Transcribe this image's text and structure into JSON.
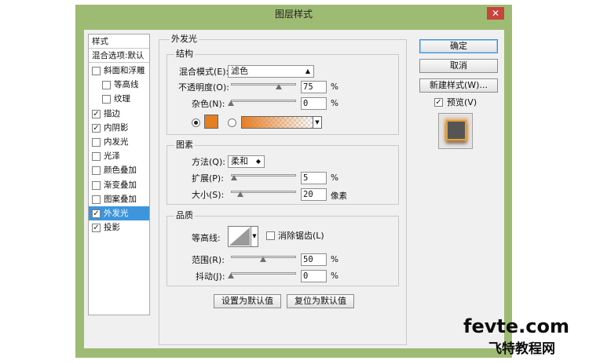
{
  "window": {
    "title": "图层样式",
    "close_glyph": "✕"
  },
  "style_list": {
    "header": "样式",
    "blend_options": "混合选项:默认",
    "items": [
      {
        "label": "斜面和浮雕",
        "checked": false
      },
      {
        "label": "等高线",
        "checked": false
      },
      {
        "label": "纹理",
        "checked": false
      },
      {
        "label": "描边",
        "checked": true
      },
      {
        "label": "内阴影",
        "checked": true
      },
      {
        "label": "内发光",
        "checked": false
      },
      {
        "label": "光泽",
        "checked": false
      },
      {
        "label": "颜色叠加",
        "checked": false
      },
      {
        "label": "渐变叠加",
        "checked": false
      },
      {
        "label": "图案叠加",
        "checked": false
      },
      {
        "label": "外发光",
        "checked": true,
        "selected": true
      },
      {
        "label": "投影",
        "checked": true
      }
    ]
  },
  "outer_glow": {
    "title": "外发光",
    "structure": {
      "title": "结构",
      "blend_mode_label": "混合模式(E):",
      "blend_mode_value": "滤色",
      "opacity_label": "不透明度(O):",
      "opacity_value": "75",
      "opacity_unit": "%",
      "noise_label": "杂色(N):",
      "noise_value": "0",
      "noise_unit": "%",
      "color_mode": "solid",
      "glow_color": "#e67e22",
      "gradient_from": "#e67e22"
    },
    "elements": {
      "title": "图素",
      "method_label": "方法(Q):",
      "method_value": "柔和",
      "spread_label": "扩展(P):",
      "spread_value": "5",
      "spread_unit": "%",
      "size_label": "大小(S):",
      "size_value": "20",
      "size_unit": "像素"
    },
    "quality": {
      "title": "品质",
      "contour_label": "等高线:",
      "antialias_label": "消除锯齿(L)",
      "antialias_checked": false,
      "range_label": "范围(R):",
      "range_value": "50",
      "range_unit": "%",
      "jitter_label": "抖动(J):",
      "jitter_value": "0",
      "jitter_unit": "%"
    },
    "make_default": "设置为默认值",
    "reset_default": "复位为默认值"
  },
  "buttons": {
    "ok": "确定",
    "cancel": "取消",
    "new_style": "新建样式(W)...",
    "preview": "预览(V)",
    "preview_checked": true
  },
  "watermark": {
    "line1": "fevte.com",
    "line2": "飞特教程网"
  }
}
